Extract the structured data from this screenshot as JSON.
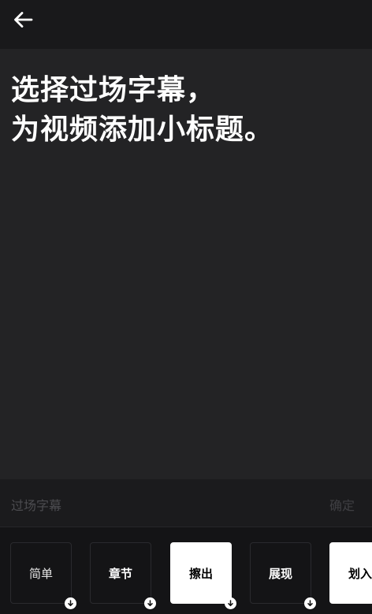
{
  "header": {
    "back_icon": "arrow-left-icon"
  },
  "preview": {
    "line1": "选择过场字幕，",
    "line2": "为视频添加小标题。"
  },
  "panel": {
    "title": "过场字幕",
    "confirm_label": "确定"
  },
  "options": [
    {
      "label": "简单",
      "selected": false,
      "badge_icon": "download-icon"
    },
    {
      "label": "章节",
      "selected": false,
      "badge_icon": "download-icon"
    },
    {
      "label": "擦出",
      "selected": true,
      "badge_icon": "download-icon"
    },
    {
      "label": "展现",
      "selected": false,
      "badge_icon": "download-icon"
    },
    {
      "label": "划入",
      "selected": false
    }
  ],
  "colors": {
    "background": "#232325",
    "top_bar": "#19191b",
    "panel": "#1b1b1d",
    "selected_option": "#ffffff",
    "muted_text": "#4c4c50"
  }
}
